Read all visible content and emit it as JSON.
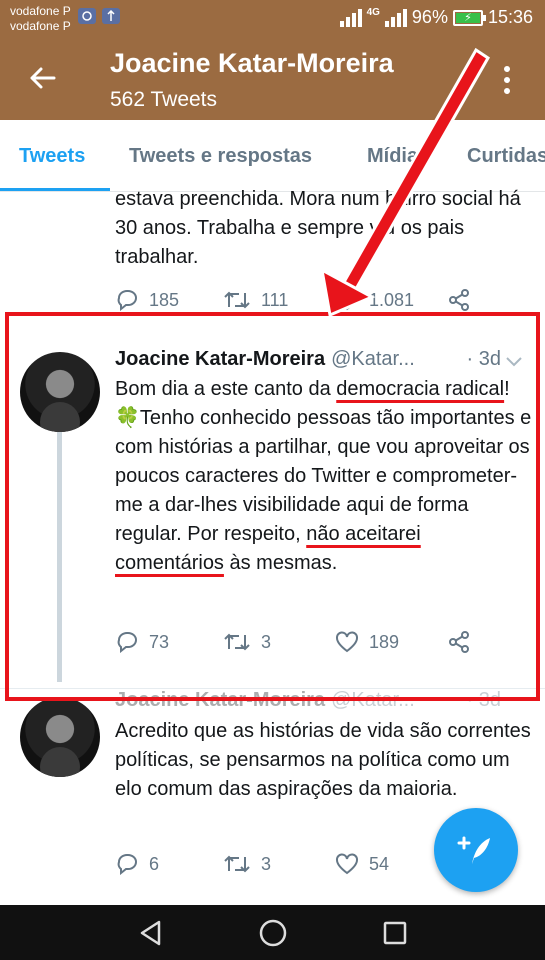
{
  "status_bar": {
    "carrier_1": "vodafone P",
    "carrier_2": "vodafone P",
    "network": "4G",
    "battery": "96%",
    "time": "15:36"
  },
  "profile_header": {
    "name": "Joacine Katar-Moreira",
    "tweet_count": "562 Tweets"
  },
  "tabs": [
    {
      "label": "Tweets",
      "active": true
    },
    {
      "label": "Tweets e respostas",
      "active": false
    },
    {
      "label": "Mídia",
      "active": false
    },
    {
      "label": "Curtidas",
      "active": false
    }
  ],
  "tweets": [
    {
      "text": "estava preenchida. Mora num bairro social há 30 anos. Trabalha e sempre viu os pais trabalhar.",
      "replies": "185",
      "retweets": "111",
      "likes": "1.081"
    },
    {
      "name": "Joacine Katar-Moreira",
      "handle": "@Katar...",
      "time": "· 3d",
      "text_parts": [
        "Bom dia a este canto da ",
        "democracia radical",
        "! ",
        "🍀",
        "Tenho conhecido pessoas tão importantes e com histórias a partilhar, que vou aproveitar os poucos caracteres do Twitter e comprometer-me a dar-lhes visibilidade aqui de forma regular. Por respeito, ",
        "não aceitarei comentários",
        " às mesmas."
      ],
      "replies": "73",
      "retweets": "3",
      "likes": "189"
    },
    {
      "name": "Joacine Katar-Moreira",
      "handle": "@Katar...",
      "time": "· 3d",
      "text": "Acredito que as histórias de vida são correntes políticas, se pensarmos na política como um elo comum das aspirações da maioria.",
      "replies": "6",
      "retweets": "3",
      "likes": "54"
    }
  ],
  "colors": {
    "header_bg": "#9b6b41",
    "accent": "#1da1f2",
    "annotation_red": "#e8141b"
  },
  "icons": [
    "back-arrow-icon",
    "more-vertical-icon",
    "reply-icon",
    "retweet-icon",
    "like-icon",
    "share-icon",
    "chevron-down-icon",
    "compose-tweet-icon",
    "nav-back-icon",
    "nav-home-icon",
    "nav-recents-icon"
  ]
}
